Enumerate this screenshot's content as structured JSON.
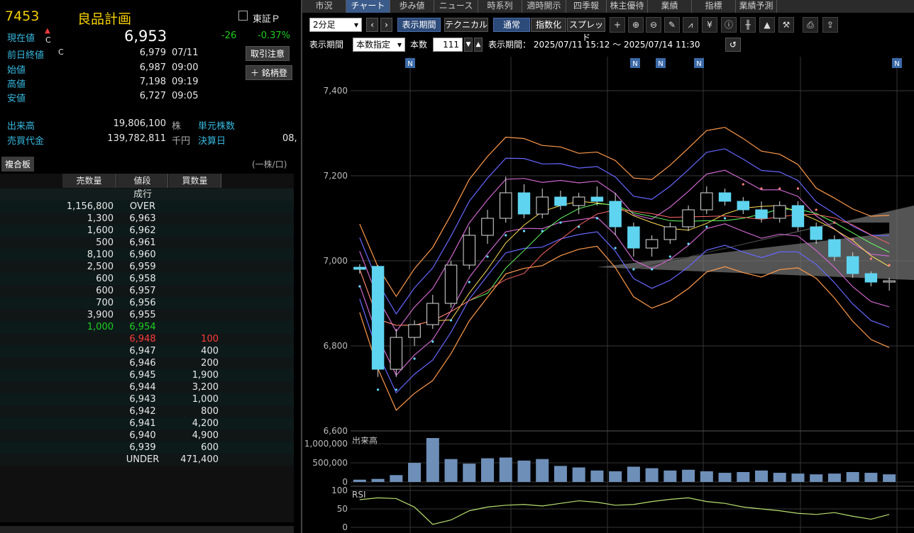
{
  "stock": {
    "code": "7453",
    "name": "良品計画",
    "market": "東証Ｐ",
    "current_label": "現在値",
    "current_mark": "C",
    "current_price": "6,953",
    "change": "-26",
    "change_pct": "-0.37%",
    "order_button": "取引注意",
    "add_button_plus": "＋",
    "add_button_label": "銘柄登"
  },
  "quote_rows": [
    {
      "label": "前日終値",
      "mark": "C",
      "value": "6,979",
      "time": "07/11"
    },
    {
      "label": "始値",
      "mark": "",
      "value": "6,987",
      "time": "09:00"
    },
    {
      "label": "高値",
      "mark": "",
      "value": "7,198",
      "time": "09:19"
    },
    {
      "label": "安値",
      "mark": "",
      "value": "6,727",
      "time": "09:05"
    }
  ],
  "volume": {
    "label": "出来高",
    "value": "19,806,100",
    "unit": "株",
    "unit_label": "単元株数"
  },
  "turnover": {
    "label": "売買代金",
    "value": "139,782,811",
    "unit": "千円",
    "settle_label": "決算日",
    "settle_value": "08,"
  },
  "board": {
    "tab": "複合板",
    "unit_note": "(一株/口)",
    "headers": [
      "売数量",
      "値段",
      "買数量"
    ],
    "market_order": "成行",
    "rows": [
      {
        "sell": "1,156,800",
        "price": "OVER",
        "buy": "",
        "type": "sell"
      },
      {
        "sell": "1,300",
        "price": "6,963",
        "buy": "",
        "type": "sell"
      },
      {
        "sell": "1,600",
        "price": "6,962",
        "buy": "",
        "type": "sell"
      },
      {
        "sell": "500",
        "price": "6,961",
        "buy": "",
        "type": "sell"
      },
      {
        "sell": "8,100",
        "price": "6,960",
        "buy": "",
        "type": "sell"
      },
      {
        "sell": "2,500",
        "price": "6,959",
        "buy": "",
        "type": "sell"
      },
      {
        "sell": "600",
        "price": "6,958",
        "buy": "",
        "type": "sell"
      },
      {
        "sell": "600",
        "price": "6,957",
        "buy": "",
        "type": "sell"
      },
      {
        "sell": "700",
        "price": "6,956",
        "buy": "",
        "type": "sell"
      },
      {
        "sell": "3,900",
        "price": "6,955",
        "buy": "",
        "type": "sell"
      },
      {
        "sell": "1,000",
        "price": "6,954",
        "buy": "",
        "type": "best-sell"
      },
      {
        "sell": "",
        "price": "6,948",
        "buy": "100",
        "type": "best-buy"
      },
      {
        "sell": "",
        "price": "6,947",
        "buy": "400",
        "type": "buy"
      },
      {
        "sell": "",
        "price": "6,946",
        "buy": "200",
        "type": "buy"
      },
      {
        "sell": "",
        "price": "6,945",
        "buy": "1,900",
        "type": "buy"
      },
      {
        "sell": "",
        "price": "6,944",
        "buy": "3,200",
        "type": "buy"
      },
      {
        "sell": "",
        "price": "6,943",
        "buy": "1,000",
        "type": "buy"
      },
      {
        "sell": "",
        "price": "6,942",
        "buy": "800",
        "type": "buy"
      },
      {
        "sell": "",
        "price": "6,941",
        "buy": "4,200",
        "type": "buy"
      },
      {
        "sell": "",
        "price": "6,940",
        "buy": "4,900",
        "type": "buy"
      },
      {
        "sell": "",
        "price": "6,939",
        "buy": "600",
        "type": "buy"
      },
      {
        "sell": "",
        "price": "UNDER",
        "buy": "471,400",
        "type": "buy"
      }
    ]
  },
  "tabs": [
    "市況",
    "チャート",
    "歩み値",
    "ニュース",
    "時系列",
    "適時開示",
    "四季報",
    "株主優待",
    "業績",
    "指標",
    "業績予測"
  ],
  "active_tab": 1,
  "toolbar": {
    "interval": "2分足",
    "display_period_btn": "表示期間",
    "technical_btn": "テクニカル",
    "normal_btn": "通常",
    "index_btn": "指数化",
    "spread_btn": "スプレッド",
    "icons": [
      "plus-icon",
      "zoom-in-icon",
      "zoom-out-icon",
      "pencil-icon",
      "line-chart-icon",
      "yen-icon",
      "info-icon",
      "candlestick-icon",
      "mountain-chart-icon",
      "wrench-icon",
      "print-icon",
      "export-icon"
    ],
    "period_label": "表示期間",
    "period_select": "本数指定",
    "count_label": "本数",
    "count_value": "111",
    "range_text": "表示期間： 2025/07/11 15:12 ～ 2025/07/14 11:30"
  },
  "colors": {
    "up_green": "#1fcf1f",
    "down_red": "#ff3b3b",
    "label_blue": "#37b9e0",
    "code_yellow": "#f5d000",
    "candle_cyan": "#5ed4f0",
    "volume_bar": "#6e8fb8"
  },
  "chart_data": {
    "type": "candlestick",
    "price_axis": {
      "ylim": [
        6600,
        7480
      ],
      "ticks": [
        7400,
        7200,
        7000,
        6800,
        6600
      ],
      "tick_labels": [
        "7,400",
        "7,200",
        "7,000",
        "6,800",
        "6,600"
      ]
    },
    "news_markers": [
      "N",
      "N",
      "N",
      "N",
      "N"
    ],
    "candles": [
      {
        "o": 6985,
        "h": 6992,
        "l": 6970,
        "c": 6980
      },
      {
        "o": 6987,
        "h": 6990,
        "l": 6727,
        "c": 6745
      },
      {
        "o": 6745,
        "h": 6840,
        "l": 6727,
        "c": 6820
      },
      {
        "o": 6820,
        "h": 6860,
        "l": 6800,
        "c": 6850
      },
      {
        "o": 6850,
        "h": 6920,
        "l": 6840,
        "c": 6900
      },
      {
        "o": 6900,
        "h": 7000,
        "l": 6890,
        "c": 6990
      },
      {
        "o": 6990,
        "h": 7080,
        "l": 6980,
        "c": 7060
      },
      {
        "o": 7060,
        "h": 7120,
        "l": 7040,
        "c": 7100
      },
      {
        "o": 7100,
        "h": 7198,
        "l": 7090,
        "c": 7160
      },
      {
        "o": 7160,
        "h": 7180,
        "l": 7100,
        "c": 7110
      },
      {
        "o": 7110,
        "h": 7170,
        "l": 7100,
        "c": 7150
      },
      {
        "o": 7150,
        "h": 7165,
        "l": 7120,
        "c": 7130
      },
      {
        "o": 7130,
        "h": 7160,
        "l": 7110,
        "c": 7150
      },
      {
        "o": 7150,
        "h": 7175,
        "l": 7130,
        "c": 7140
      },
      {
        "o": 7140,
        "h": 7160,
        "l": 7060,
        "c": 7080
      },
      {
        "o": 7080,
        "h": 7090,
        "l": 7010,
        "c": 7030
      },
      {
        "o": 7030,
        "h": 7060,
        "l": 7010,
        "c": 7050
      },
      {
        "o": 7050,
        "h": 7090,
        "l": 7040,
        "c": 7080
      },
      {
        "o": 7080,
        "h": 7130,
        "l": 7070,
        "c": 7120
      },
      {
        "o": 7120,
        "h": 7175,
        "l": 7110,
        "c": 7160
      },
      {
        "o": 7160,
        "h": 7170,
        "l": 7130,
        "c": 7140
      },
      {
        "o": 7140,
        "h": 7150,
        "l": 7110,
        "c": 7120
      },
      {
        "o": 7120,
        "h": 7140,
        "l": 7090,
        "c": 7100
      },
      {
        "o": 7100,
        "h": 7140,
        "l": 7090,
        "c": 7130
      },
      {
        "o": 7130,
        "h": 7140,
        "l": 7070,
        "c": 7080
      },
      {
        "o": 7080,
        "h": 7090,
        "l": 7040,
        "c": 7050
      },
      {
        "o": 7050,
        "h": 7060,
        "l": 7000,
        "c": 7010
      },
      {
        "o": 7010,
        "h": 7020,
        "l": 6960,
        "c": 6970
      },
      {
        "o": 6970,
        "h": 6975,
        "l": 6940,
        "c": 6950
      },
      {
        "o": 6950,
        "h": 6960,
        "l": 6930,
        "c": 6953
      }
    ],
    "volume_axis": {
      "ticks": [
        1000000,
        500000,
        0
      ],
      "tick_labels": [
        "1,000,000",
        "500,000",
        "0"
      ],
      "label": "出来高",
      "ylim": [
        0,
        1150000
      ]
    },
    "volume": [
      60000,
      80000,
      180000,
      500000,
      1150000,
      600000,
      480000,
      620000,
      640000,
      560000,
      600000,
      420000,
      380000,
      300000,
      280000,
      400000,
      360000,
      300000,
      320000,
      280000,
      240000,
      260000,
      300000,
      240000,
      220000,
      200000,
      220000,
      260000,
      240000,
      200000
    ],
    "rsi_axis": {
      "ticks": [
        100,
        50,
        0
      ],
      "tick_labels": [
        "100",
        "50",
        "0"
      ],
      "label": "RSI"
    },
    "rsi": [
      75,
      80,
      78,
      55,
      8,
      20,
      45,
      55,
      60,
      62,
      58,
      65,
      72,
      68,
      60,
      62,
      70,
      76,
      80,
      70,
      65,
      55,
      50,
      45,
      38,
      35,
      40,
      30,
      22,
      35
    ]
  }
}
